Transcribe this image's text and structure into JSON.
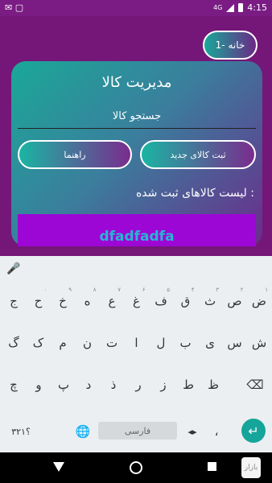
{
  "status": {
    "left": "✉ ▢",
    "net": "4G",
    "time": "4:15"
  },
  "app": {
    "home_label": "1- خانه",
    "title": "مدیریت کالا",
    "search_placeholder": "جستجو کالا",
    "guide_button": "راهنما",
    "new_button": "ثبت کالای جدید",
    "list_label": "لیست کالاهای ثبت شده :",
    "first_item": "dfadfadfa"
  },
  "keyboard": {
    "row1": [
      "ض",
      "ص",
      "ث",
      "ق",
      "ف",
      "غ",
      "ع",
      "ه",
      "خ",
      "ح",
      "ج"
    ],
    "row1_hints": [
      "۱",
      "۲",
      "۳",
      "۴",
      "۵",
      "۶",
      "۷",
      "۸",
      "۹",
      "۰",
      ""
    ],
    "row2": [
      "ش",
      "س",
      "ی",
      "ب",
      "ل",
      "ا",
      "ت",
      "ن",
      "م",
      "ک",
      "گ"
    ],
    "row3": [
      "ظ",
      "ط",
      "ز",
      "ر",
      "ذ",
      "د",
      "پ",
      "و",
      "چ"
    ],
    "numbers_label": "۳۲۱؟",
    "space_label": "فارسی",
    "comma": "،",
    "enter_glyph": "↵",
    "backspace_glyph": "⌫",
    "mic_glyph": "🎤",
    "globe_glyph": "🌐"
  },
  "navbar": {
    "logo_text": "بازار"
  }
}
